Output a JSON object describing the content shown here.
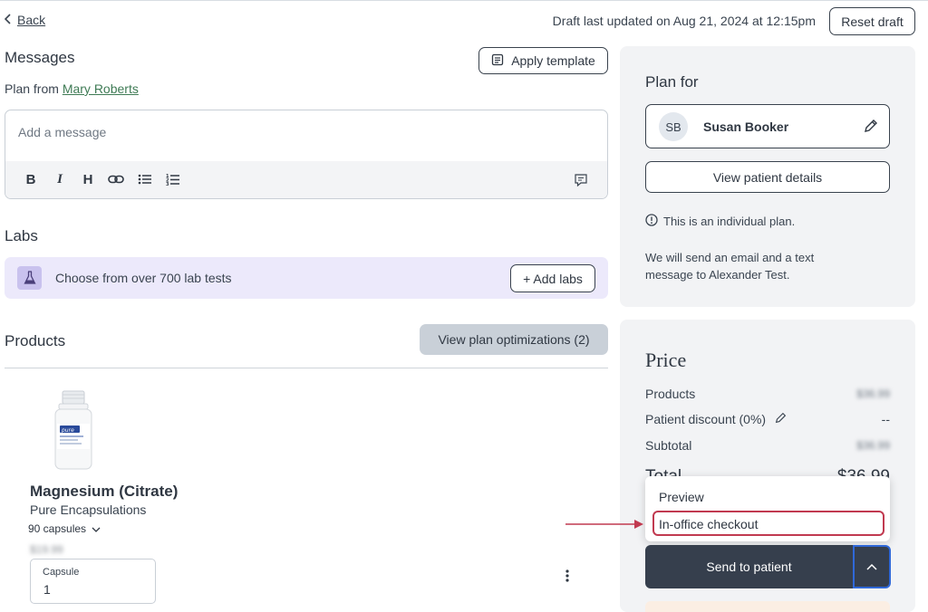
{
  "header": {
    "back_label": "Back",
    "draft_status": "Draft last updated on Aug 21, 2024 at 12:15pm",
    "reset_label": "Reset draft"
  },
  "messages": {
    "title": "Messages",
    "apply_template_label": "Apply template",
    "plan_from_prefix": "Plan from",
    "plan_from_name": "Mary Roberts",
    "placeholder": "Add a message",
    "toolbar": [
      "bold-icon",
      "italic-icon",
      "heading-icon",
      "link-icon",
      "bullet-list-icon",
      "numbered-list-icon",
      "comment-icon"
    ]
  },
  "labs": {
    "title": "Labs",
    "prompt": "Choose from over 700 lab tests",
    "add_label": "+ Add labs"
  },
  "products": {
    "title": "Products",
    "optimizations_label": "View plan optimizations (2)",
    "item": {
      "name": "Magnesium (Citrate)",
      "brand": "Pure Encapsulations",
      "variant": "90 capsules",
      "price": "$19.99",
      "qty_label": "Capsule",
      "qty_value": "1",
      "bottle_brand": "pure"
    }
  },
  "plan": {
    "title": "Plan for",
    "patient_initials": "SB",
    "patient_name": "Susan Booker",
    "view_details_label": "View patient details",
    "individual_note": "This is an individual plan.",
    "send_note": "We will send an email and a text message to Alexander Test."
  },
  "price": {
    "title": "Price",
    "products_label": "Products",
    "products_value": "$36.99",
    "discount_label": "Patient discount (0%)",
    "discount_value": "--",
    "subtotal_label": "Subtotal",
    "subtotal_value": "$36.99",
    "total_label": "Total",
    "total_value": "$36.99"
  },
  "dropdown": {
    "preview_label": "Preview",
    "in_office_label": "In-office checkout"
  },
  "send": {
    "label": "Send to patient"
  },
  "colors": {
    "accent_dark": "#363f4d",
    "link_green": "#3f7b55",
    "labs_bg": "#ece9fb",
    "highlight_red": "#c13a50",
    "focus_blue": "#2f68d8"
  }
}
